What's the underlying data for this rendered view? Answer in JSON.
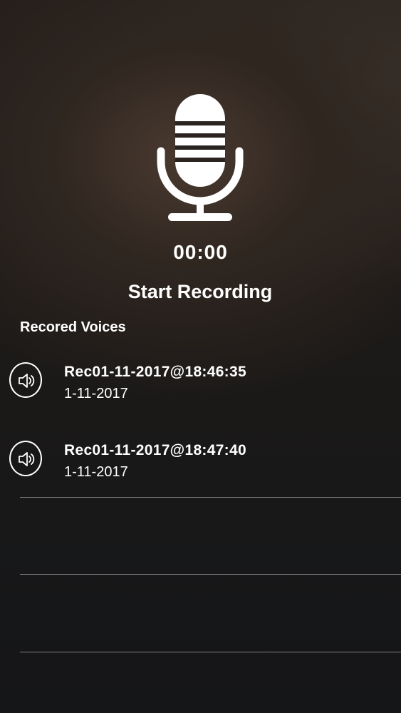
{
  "recorder": {
    "timer": "00:00",
    "start_label": "Start Recording",
    "mic_icon": "microphone-icon"
  },
  "recordings": {
    "section_title": "Recored Voices",
    "speaker_icon": "speaker-icon",
    "items": [
      {
        "name": "Rec01-11-2017@18:46:35",
        "date": "1-11-2017"
      },
      {
        "name": "Rec01-11-2017@18:47:40",
        "date": "1-11-2017"
      }
    ]
  },
  "colors": {
    "text": "#ffffff",
    "background": "#1d1a18"
  }
}
